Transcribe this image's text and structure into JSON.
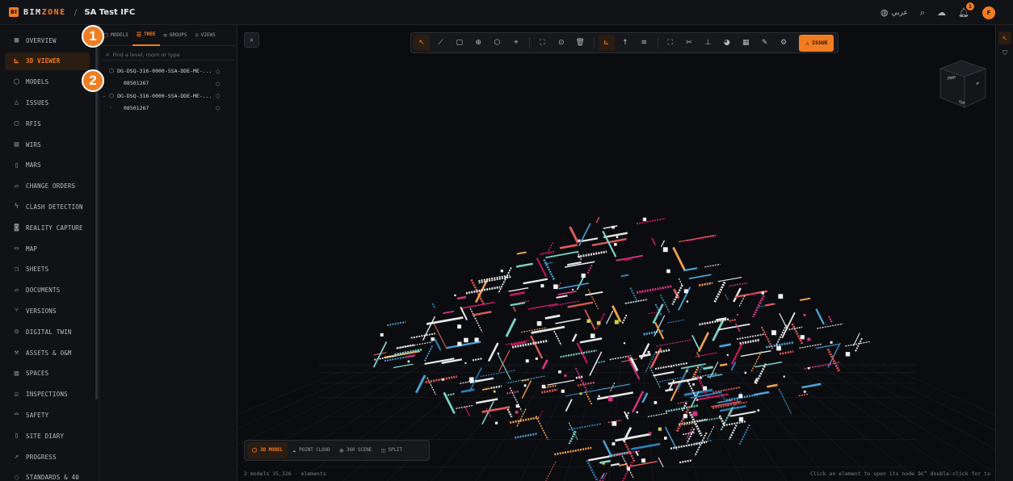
{
  "header": {
    "logo_mark": "BI",
    "logo_text_a": "BIM",
    "logo_text_b": "ZONE",
    "separator": "/",
    "project": "SA Test IFC",
    "language": "عربي",
    "notification_count": "1",
    "avatar_initial": "F"
  },
  "sidebar": {
    "items": [
      {
        "label": "OVERVIEW",
        "icon": "grid-icon",
        "glyph": "▦"
      },
      {
        "label": "3D VIEWER",
        "icon": "axes-icon",
        "glyph": "⊾"
      },
      {
        "label": "MODELS",
        "icon": "cubes-icon",
        "glyph": "⬡"
      },
      {
        "label": "ISSUES",
        "icon": "warning-icon",
        "glyph": "△"
      },
      {
        "label": "RFIS",
        "icon": "chat-icon",
        "glyph": "▢"
      },
      {
        "label": "WIRS",
        "icon": "clipboard-icon",
        "glyph": "▤"
      },
      {
        "label": "MARS",
        "icon": "file-icon",
        "glyph": "▯"
      },
      {
        "label": "CHANGE ORDERS",
        "icon": "document-edit-icon",
        "glyph": "▱"
      },
      {
        "label": "CLASH DETECTION",
        "icon": "lightning-icon",
        "glyph": "ϟ"
      },
      {
        "label": "REALITY CAPTURE",
        "icon": "camera-icon",
        "glyph": "◙"
      },
      {
        "label": "MAP",
        "icon": "map-icon",
        "glyph": "▭"
      },
      {
        "label": "SHEETS",
        "icon": "layers-icon",
        "glyph": "❐"
      },
      {
        "label": "DOCUMENTS",
        "icon": "folder-icon",
        "glyph": "▱"
      },
      {
        "label": "VERSIONS",
        "icon": "branch-icon",
        "glyph": "⑂"
      },
      {
        "label": "DIGITAL TWIN",
        "icon": "target-icon",
        "glyph": "◎"
      },
      {
        "label": "ASSETS & O&M",
        "icon": "wrench-icon",
        "glyph": "⚒"
      },
      {
        "label": "SPACES",
        "icon": "building-icon",
        "glyph": "▥"
      },
      {
        "label": "INSPECTIONS",
        "icon": "checklist-icon",
        "glyph": "☑"
      },
      {
        "label": "SAFETY",
        "icon": "hardhat-icon",
        "glyph": "⌓"
      },
      {
        "label": "SITE DIARY",
        "icon": "book-icon",
        "glyph": "▯"
      },
      {
        "label": "PROGRESS",
        "icon": "trend-icon",
        "glyph": "↗"
      },
      {
        "label": "STANDARDS & 40",
        "icon": "badge-check-icon",
        "glyph": "◌"
      }
    ],
    "active_index": 1
  },
  "panel": {
    "tabs": [
      {
        "label": "MODELS",
        "icon": "cubes-icon",
        "glyph": "⬡"
      },
      {
        "label": "TREE",
        "icon": "tree-icon",
        "glyph": "☰"
      },
      {
        "label": "GROUPS",
        "icon": "layers-icon",
        "glyph": "≋"
      },
      {
        "label": "VIEWS",
        "icon": "bookmark-icon",
        "glyph": "⌑"
      }
    ],
    "active_tab": 1,
    "search_placeholder": "Find a level, room or type",
    "tree": [
      {
        "label": "DG-DSQ-316-0000-SSA-DDE-ME-...",
        "chev": "",
        "level": 0
      },
      {
        "label": "08501267",
        "chev": "",
        "level": 1
      },
      {
        "label": "DG-DSQ-316-0000-SSA-DDE-ME-...",
        "chev": "⌄",
        "level": 0
      },
      {
        "label": "08501267",
        "chev": "›",
        "level": 1
      }
    ]
  },
  "markers": [
    "1",
    "2"
  ],
  "toolbar": {
    "tools": [
      {
        "name": "select-tool",
        "glyph": "↖",
        "on": true
      },
      {
        "name": "measure-tool",
        "glyph": "⟋",
        "on": false
      },
      {
        "name": "box-tool",
        "glyph": "▢",
        "on": false
      },
      {
        "name": "crosshair-tool",
        "glyph": "⊕",
        "on": false
      },
      {
        "name": "cube-tool",
        "glyph": "⬡",
        "on": false
      },
      {
        "name": "pin-tool",
        "glyph": "⌖",
        "on": false
      },
      {
        "name": "sep",
        "glyph": "",
        "on": false
      },
      {
        "name": "frame-tool",
        "glyph": "⛶",
        "on": false
      },
      {
        "name": "location-tool",
        "glyph": "⊙",
        "on": false
      },
      {
        "name": "trash-tool",
        "glyph": "🗑",
        "on": false
      },
      {
        "name": "sep",
        "glyph": "",
        "on": false
      },
      {
        "name": "axes-tool",
        "glyph": "⊾",
        "on": true
      },
      {
        "name": "walk-tool",
        "glyph": "☨",
        "on": false
      },
      {
        "name": "layers-tool",
        "glyph": "≋",
        "on": false
      },
      {
        "name": "sep",
        "glyph": "",
        "on": false
      },
      {
        "name": "fit-tool",
        "glyph": "⛶",
        "on": false
      },
      {
        "name": "scissors-tool",
        "glyph": "✂",
        "on": false
      },
      {
        "name": "section-tool",
        "glyph": "⊥",
        "on": false
      },
      {
        "name": "palette-tool",
        "glyph": "◕",
        "on": false
      },
      {
        "name": "calendar-tool",
        "glyph": "▦",
        "on": false
      },
      {
        "name": "pencil-tool",
        "glyph": "✎",
        "on": false
      },
      {
        "name": "settings-tool",
        "glyph": "⚙",
        "on": false
      }
    ],
    "issue_label": "ISSUE"
  },
  "modes": [
    {
      "label": "3D MODEL",
      "icon": "cube-icon",
      "glyph": "⬡",
      "on": true
    },
    {
      "label": "POINT CLOUD",
      "icon": "cloud-icon",
      "glyph": "☁",
      "on": false
    },
    {
      "label": "360 SCENE",
      "icon": "globe-icon",
      "glyph": "◍",
      "on": false
    },
    {
      "label": "SPLIT",
      "icon": "split-icon",
      "glyph": "◫",
      "on": false
    }
  ],
  "status": {
    "left": "2 models 35,326 · elements",
    "right": "Click an element to open its node â€” double-click for to"
  },
  "viewcube": {
    "front": "FRNT",
    "right": "R",
    "bottom": "TOP"
  }
}
